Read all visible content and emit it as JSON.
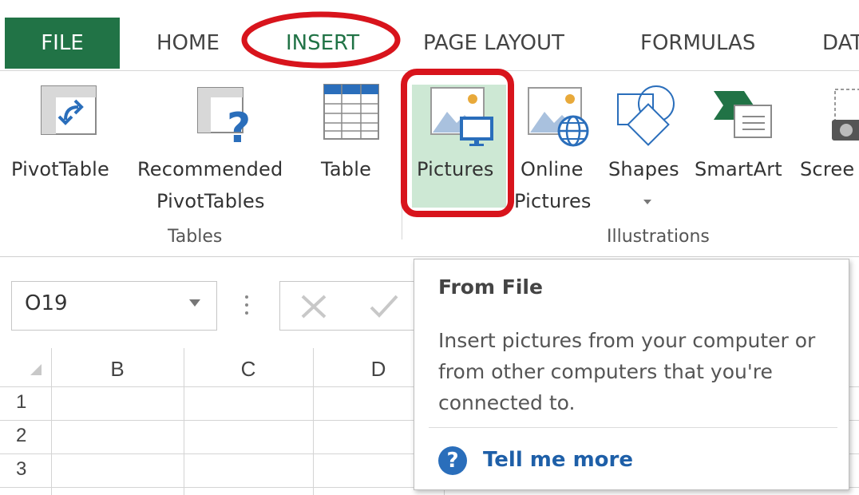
{
  "tabs": {
    "file": "FILE",
    "home": "HOME",
    "insert": "INSERT",
    "page_layout": "PAGE LAYOUT",
    "formulas": "FORMULAS",
    "data": "DAT"
  },
  "ribbon": {
    "pivottable": "PivotTable",
    "recommended_line1": "Recommended",
    "recommended_line2": "PivotTables",
    "table": "Table",
    "pictures": "Pictures",
    "online_line1": "Online",
    "online_line2": "Pictures",
    "shapes": "Shapes",
    "smartart": "SmartArt",
    "screenshot": "Scree",
    "group_tables": "Tables",
    "group_illustrations": "Illustrations"
  },
  "formula_bar": {
    "namebox_value": "O19"
  },
  "grid": {
    "columns": [
      "B",
      "C",
      "D"
    ],
    "rows": [
      "1",
      "2",
      "3"
    ]
  },
  "tooltip": {
    "title": "From File",
    "description": "Insert pictures from your computer or from other computers that you're connected to.",
    "help_label": "Tell me more",
    "help_icon": "?"
  },
  "colors": {
    "file_tab_bg": "#217346",
    "active_tab_text": "#217346",
    "annotation_red": "#d8141c",
    "pictures_highlight": "#cde8d4",
    "help_blue": "#2a6ebb"
  }
}
